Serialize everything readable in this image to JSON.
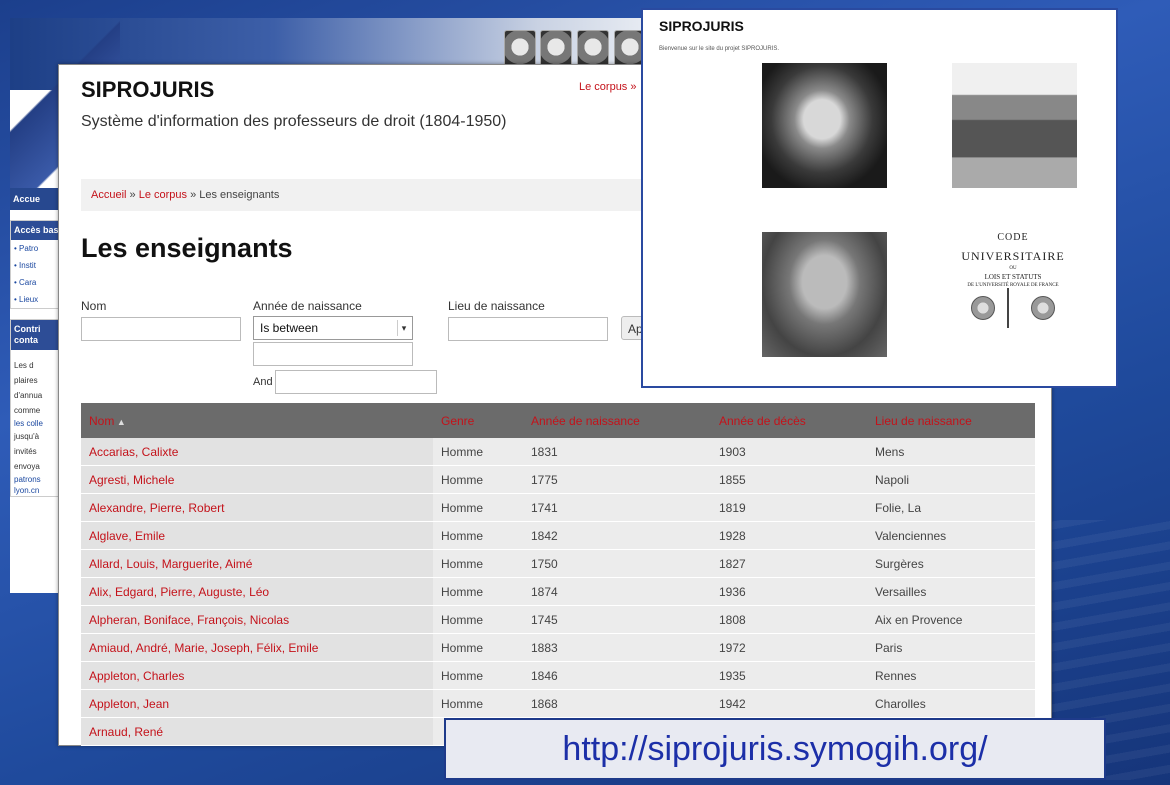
{
  "back_window": {
    "sidebar": {
      "accueil": "Accue",
      "block1_title": "Accès base",
      "items": [
        "Patro",
        "Instit",
        "Cara",
        "Lieux"
      ],
      "block2_title": "Contri conta",
      "text_lines": [
        "Les d",
        "plaires",
        "d'annua",
        "comme",
        "les colle",
        "jusqu'à",
        "invités",
        "envoya",
        "patrons",
        "lyon.cn"
      ]
    }
  },
  "main": {
    "site_title": "SIPROJURIS",
    "site_subtitle": "Système d'information des professeurs de droit (1804-1950)",
    "top_nav": "Le corpus »",
    "breadcrumb": {
      "home": "Accueil",
      "sep1": " » ",
      "corpus": "Le corpus",
      "sep2": " » ",
      "current": "Les enseignants"
    },
    "page_title": "Les enseignants",
    "filters": {
      "nom_label": "Nom",
      "annee_label": "Année de naissance",
      "lieu_label": "Lieu de naissance",
      "operator_value": "Is between",
      "and_label": "And",
      "apply_label": "Ap"
    },
    "table": {
      "headers": {
        "nom": "Nom",
        "genre": "Genre",
        "naissance": "Année de naissance",
        "deces": "Année de décès",
        "lieu": "Lieu de naissance"
      },
      "rows": [
        {
          "nom": "Accarias, Calixte",
          "genre": "Homme",
          "naissance": "1831",
          "deces": "1903",
          "lieu": "Mens"
        },
        {
          "nom": "Agresti, Michele",
          "genre": "Homme",
          "naissance": "1775",
          "deces": "1855",
          "lieu": "Napoli"
        },
        {
          "nom": "Alexandre, Pierre, Robert",
          "genre": "Homme",
          "naissance": "1741",
          "deces": "1819",
          "lieu": "Folie, La"
        },
        {
          "nom": "Alglave, Emile",
          "genre": "Homme",
          "naissance": "1842",
          "deces": "1928",
          "lieu": "Valenciennes"
        },
        {
          "nom": "Allard, Louis, Marguerite, Aimé",
          "genre": "Homme",
          "naissance": "1750",
          "deces": "1827",
          "lieu": "Surgères"
        },
        {
          "nom": "Alix, Edgard, Pierre, Auguste, Léo",
          "genre": "Homme",
          "naissance": "1874",
          "deces": "1936",
          "lieu": "Versailles"
        },
        {
          "nom": "Alpheran, Boniface, François, Nicolas",
          "genre": "Homme",
          "naissance": "1745",
          "deces": "1808",
          "lieu": "Aix en Provence"
        },
        {
          "nom": "Amiaud, André, Marie, Joseph, Félix, Emile",
          "genre": "Homme",
          "naissance": "1883",
          "deces": "1972",
          "lieu": "Paris"
        },
        {
          "nom": "Appleton, Charles",
          "genre": "Homme",
          "naissance": "1846",
          "deces": "1935",
          "lieu": "Rennes"
        },
        {
          "nom": "Appleton, Jean",
          "genre": "Homme",
          "naissance": "1868",
          "deces": "1942",
          "lieu": "Charolles"
        },
        {
          "nom": "Arnaud, René",
          "genre": "",
          "naissance": "",
          "deces": "",
          "lieu": ""
        }
      ]
    }
  },
  "popup": {
    "title": "SIPROJURIS",
    "welcome": "Bienvenue sur le site du projet SIPROJURIS.",
    "code_lines": [
      "CODE",
      "UNIVERSITAIRE",
      "OU",
      "LOIS ET STATUTS",
      "DE L'UNIVERSITÉ ROYALE DE FRANCE"
    ]
  },
  "url_caption": "http://siprojuris.symogih.org/"
}
